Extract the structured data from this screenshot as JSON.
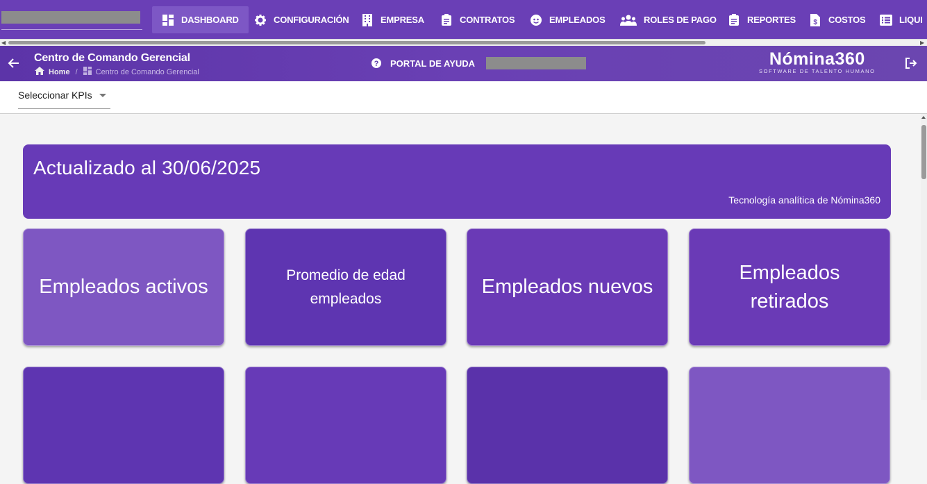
{
  "topnav": {
    "items": [
      {
        "label": "DASHBOARD",
        "icon": "dashboard-icon"
      },
      {
        "label": "CONFIGURACIÓN",
        "icon": "gear-icon"
      },
      {
        "label": "EMPRESA",
        "icon": "building-icon"
      },
      {
        "label": "CONTRATOS",
        "icon": "clipboard-icon"
      },
      {
        "label": "EMPLEADOS",
        "icon": "face-icon"
      },
      {
        "label": "ROLES DE PAGO",
        "icon": "users-icon"
      },
      {
        "label": "REPORTES",
        "icon": "clipboard-icon"
      },
      {
        "label": "COSTOS",
        "icon": "dollar-file-icon"
      },
      {
        "label": "LIQUI",
        "icon": "list-icon"
      }
    ]
  },
  "header": {
    "title": "Centro de Comando Gerencial",
    "breadcrumb_home": "Home",
    "breadcrumb_separator": "/",
    "breadcrumb_current": "Centro de Comando Gerencial",
    "help_label": "PORTAL DE AYUDA",
    "brand_name": "Nómina360",
    "brand_tagline": "SOFTWARE DE TALENTO HUMANO"
  },
  "kpi": {
    "select_label": "Seleccionar KPIs"
  },
  "banner": {
    "updated": "Actualizado al 30/06/2025",
    "tech": "Tecnología analítica de Nómina360"
  },
  "cards": [
    {
      "label": "Empleados activos"
    },
    {
      "label": "Promedio de edad empleados"
    },
    {
      "label": "Empleados nuevos"
    },
    {
      "label": "Empleados retirados"
    }
  ],
  "colors": {
    "primary": "#6a3fb6",
    "card_dark": "#5e35b1",
    "card_light": "#7e57c2",
    "background": "#f4f4f4"
  }
}
